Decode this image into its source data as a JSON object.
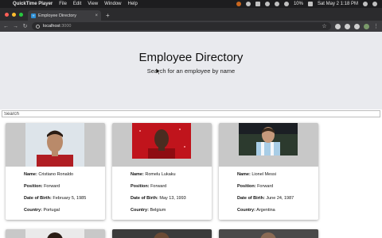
{
  "menubar": {
    "app_name": "QuickTime Player",
    "menus": [
      "File",
      "Edit",
      "View",
      "Window",
      "Help"
    ],
    "battery": "10%",
    "datetime": "Sat May 2  1:18 PM"
  },
  "browser": {
    "tab_title": "Employee Directory",
    "url_host": "localhost",
    "url_port": ":3000"
  },
  "page": {
    "title": "Employee Directory",
    "subtitle": "Search for an employee by name",
    "search_placeholder": "Search",
    "labels": {
      "name": "Name:",
      "position": "Position:",
      "dob": "Date of Birth:",
      "country": "Country:"
    },
    "employees": [
      {
        "name": "Cristiano Ronaldo",
        "position": "Forward",
        "dob": "February 5, 1985",
        "country": "Portugal"
      },
      {
        "name": "Romelu Lukaku",
        "position": "Forward",
        "dob": "May 13, 1993",
        "country": "Belgium"
      },
      {
        "name": "Lionel Messi",
        "position": "Forward",
        "dob": "June 24, 1987",
        "country": "Argentina"
      }
    ]
  },
  "colors": {
    "hero_bg": "#e9eaee",
    "card_image_bg": "#c8c8c8",
    "chrome_dark": "#2b2b2d"
  }
}
